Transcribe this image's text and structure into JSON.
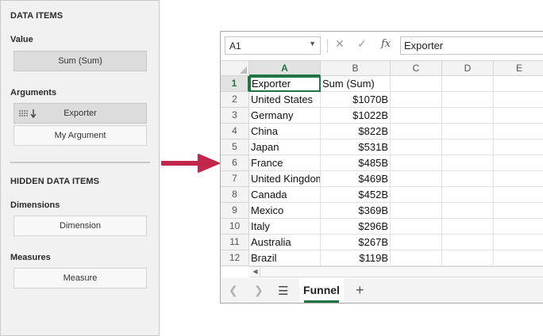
{
  "panel": {
    "data_items_title": "DATA ITEMS",
    "value": {
      "label": "Value",
      "items": [
        "Sum (Sum)"
      ]
    },
    "arguments": {
      "label": "Arguments",
      "items": [
        "Exporter",
        "My Argument"
      ]
    },
    "hidden_title": "HIDDEN DATA ITEMS",
    "dimensions": {
      "label": "Dimensions",
      "items": [
        "Dimension"
      ]
    },
    "measures": {
      "label": "Measures",
      "items": [
        "Measure"
      ]
    }
  },
  "arrow_color": "#c2264b",
  "spreadsheet": {
    "name_box": "A1",
    "formula_icons": [
      "cancel-icon",
      "enter-icon",
      "function-icon"
    ],
    "formula_value": "Exporter",
    "columns": [
      "A",
      "B",
      "C",
      "D",
      "E"
    ],
    "selected_column": "A",
    "selected_row": "1",
    "rows": [
      {
        "row": "1",
        "a": "Exporter",
        "b": "Sum (Sum)"
      },
      {
        "row": "2",
        "a": "United States",
        "b": "$1070B"
      },
      {
        "row": "3",
        "a": "Germany",
        "b": "$1022B"
      },
      {
        "row": "4",
        "a": "China",
        "b": "$822B"
      },
      {
        "row": "5",
        "a": "Japan",
        "b": "$531B"
      },
      {
        "row": "6",
        "a": "France",
        "b": "$485B"
      },
      {
        "row": "7",
        "a": "United Kingdom",
        "b": "$469B"
      },
      {
        "row": "8",
        "a": "Canada",
        "b": "$452B"
      },
      {
        "row": "9",
        "a": "Mexico",
        "b": "$369B"
      },
      {
        "row": "10",
        "a": "Italy",
        "b": "$296B"
      },
      {
        "row": "11",
        "a": "Australia",
        "b": "$267B"
      },
      {
        "row": "12",
        "a": "Brazil",
        "b": "$119B"
      }
    ],
    "sheet_tabs": [
      "Funnel"
    ],
    "accent_color": "#217346"
  }
}
